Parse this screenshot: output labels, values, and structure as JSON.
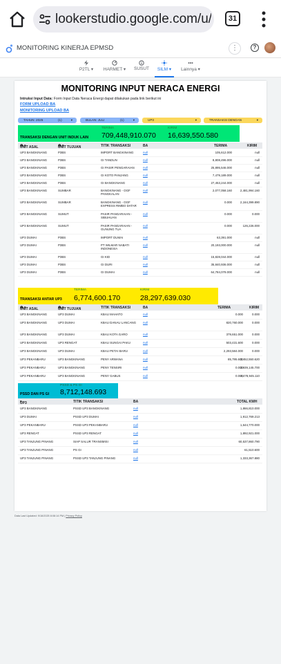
{
  "browser": {
    "url": "lookerstudio.google.com/u/0",
    "tab_count": "31"
  },
  "app": {
    "title": "MONITORING KINERJA EPMSD"
  },
  "nav_tabs": [
    {
      "label": "P2TL",
      "icon": "bolt-icon",
      "has_menu": true
    },
    {
      "label": "HARMET",
      "icon": "gauge-icon",
      "has_menu": true
    },
    {
      "label": "SUSUT",
      "icon": "info-icon",
      "has_menu": false
    },
    {
      "label": "SILM",
      "icon": "sun-icon",
      "has_menu": true,
      "active": true
    },
    {
      "label": "Lainnya",
      "icon": "dots-icon",
      "has_menu": true
    }
  ],
  "report": {
    "title": "MONITORING INPUT NERACA ENERGI",
    "intro_bold": "Intruksi Input Data:",
    "intro_text": " Form Input Data Neraca Energi dapat dilakukan pada link berikut ini",
    "links": [
      "FORM UPLOAD BA",
      "MONITORING UPLOAD BA"
    ],
    "filters": [
      {
        "label": "TAHUN: 2025",
        "count": "(1)"
      },
      {
        "label": "BULAN: JULI",
        "count": "(1)"
      },
      {
        "label": "UP3",
        "count": ""
      },
      {
        "label": "TRANSAKSI DENGAN",
        "count": ""
      }
    ],
    "section1": {
      "title": "TRANSAKSI DENGAN UNIT INDUK LAIN",
      "terima_label": "TERIMA",
      "terima_value": "709,448,910.070",
      "kirim_label": "KIRIM",
      "kirim_value": "16,639,550.580",
      "headers": [
        "UNIT ASAL",
        "UNIT TUJUAN",
        "TITIK TRANSAKSI",
        "BA",
        "TERIMA",
        "KIRIM"
      ],
      "rows": [
        [
          "UP3 BANGKINANG",
          "P3BS",
          "IMPORT BANGKINANG",
          "null",
          "105,612.000",
          "null"
        ],
        [
          "UP3 BANGKINANG",
          "P3BS",
          "GI TANDUN",
          "null",
          "8,808,496.000",
          "null"
        ],
        [
          "UP3 BANGKINANG",
          "P3BS",
          "GI PASIR PENGARAIAN",
          "null",
          "25,895,546.000",
          "null"
        ],
        [
          "UP3 BANGKINANG",
          "P3BS",
          "GI KOTO PANJANG",
          "null",
          "7,479,189.000",
          "null"
        ],
        [
          "UP3 BANGKINANG",
          "P3BS",
          "GI BANGKINANG",
          "null",
          "27,453,244.000",
          "null"
        ],
        [
          "UP3 BANGKINANG",
          "SUMBAR",
          "BANGKINANG - OGF PANGKALAN",
          "null",
          "2,077,058.160",
          "2,481,994.160"
        ],
        [
          "UP3 BANGKINANG",
          "SUMBAR",
          "BANGKINANG - OGF EXPRESS RIMBO DATAR",
          "null",
          "0.000",
          "2,164,399.890"
        ],
        [
          "UP3 BANGKINANG",
          "SUMUT",
          "PASIR PANGARAIAN - SIBUHUAN",
          "null",
          "0.000",
          "0.000"
        ],
        [
          "UP3 BANGKINANG",
          "SUMUT",
          "PASIR PANGARAIAN - GUNUNG TUA",
          "null",
          "0.000",
          "126,226.000"
        ],
        [
          "UP3 DUMAI",
          "P3BS",
          "IMPORT DUMAI",
          "null",
          "63,391.000",
          "null"
        ],
        [
          "UP3 DUMAI",
          "P3BS",
          "PT WILMAR NABATI INDONESIA",
          "null",
          "20,193,000.000",
          "null"
        ],
        [
          "UP3 DUMAI",
          "P3BS",
          "GI KID",
          "null",
          "15,828,044.000",
          "null"
        ],
        [
          "UP3 DUMAI",
          "P3BS",
          "GI DURI",
          "null",
          "35,840,936.000",
          "null"
        ],
        [
          "UP3 DUMAI",
          "P3BS",
          "GI DUMAI",
          "null",
          "64,784,078.000",
          "null"
        ]
      ]
    },
    "section2": {
      "title": "TRANSAKSI ANTAR UP3",
      "terima_label": "TERIMA",
      "terima_value": "6,774,600.170",
      "kirim_label": "KIRIM",
      "kirim_value": "28,297,639.030",
      "headers": [
        "UNIT ASAL",
        "UNIT TUJUAN",
        "TITIK TRANSAKSI",
        "BA",
        "TERIMA",
        "KIRIM"
      ],
      "rows": [
        [
          "UP3 BANGKINANG",
          "UP3 DUMAI",
          "KBAU MAHATO",
          "null",
          "0.000",
          "0.000"
        ],
        [
          "UP3 BANGKINANG",
          "UP3 DUMAI",
          "KBAU DANAU LANCANG",
          "null",
          "820,760.000",
          "0.000"
        ],
        [
          "UP3 BANGKINANG",
          "UP3 DUMAI",
          "KBAU KOTA GARO",
          "null",
          "379,651.000",
          "0.000"
        ],
        [
          "UP3 BANGKINANG",
          "UP3 RENGAT",
          "KBAU SUNGAI PAKU",
          "null",
          "503,431.600",
          "0.000"
        ],
        [
          "UP3 BANGKINANG",
          "UP3 DUMAI",
          "KBAU PETAI BARU",
          "null",
          "2,293,584.000",
          "0.000"
        ],
        [
          "UP3 PEKANBARU",
          "UP3 BANGKINANG",
          "PENY ARWANA",
          "null",
          "85,795.600",
          "3,452,550.620"
        ],
        [
          "UP3 PEKANBARU",
          "UP3 BANGKINANG",
          "PENY TENSIRI",
          "null",
          "0.000",
          "3,939,145.700"
        ],
        [
          "UP3 PEKANBARU",
          "UP3 BANGKINANG",
          "PENY GABUS",
          "null",
          "0.000",
          "4,478,945.110"
        ]
      ]
    },
    "section3": {
      "title": "PSSD DAN PS GI",
      "total_label": "PSSD & PS GI",
      "total_value": "8,712,148.693",
      "headers": [
        "UP3",
        "TITIK TRANSAKSI",
        "BA",
        "TOTAL KWH"
      ],
      "rows": [
        [
          "UP3 BANGKINANG",
          "PSSD UP3 BANGKINANG",
          "null",
          "1,866,810.000"
        ],
        [
          "UP3 DUMAI",
          "PSSD UP3 DUMAI",
          "null",
          "1,912,769.213"
        ],
        [
          "UP3 PEKANBARU",
          "PSSD UP3 PEKANBARU",
          "null",
          "1,644,770.000"
        ],
        [
          "UP3 RENGAT",
          "PSSD UP3 RENGAT",
          "null",
          "1,892,921.000"
        ],
        [
          "UP3 TANJUNG PINANG",
          "SIAP SALUR TRANSMISI",
          "null",
          "60,537,860.790"
        ],
        [
          "UP3 TANJUNG PINANG",
          "PS GI",
          "null",
          "61,510.600"
        ],
        [
          "UP3 TANJUNG PINANG",
          "PSSD UP3 TANJUNG PINANG",
          "null",
          "1,333,367.880"
        ]
      ]
    }
  },
  "footer": {
    "updated": "Data Last Updated: 9/16/2025 8:08:14 PM",
    "separator": " | ",
    "privacy": "Privacy Policy"
  },
  "colors": {
    "accent": "#1a73e8",
    "highlight_green": "#00e676",
    "highlight_yellow": "#ffea00",
    "highlight_cyan": "#00bcd4",
    "filter_yellow": "#fbd75b",
    "filter_blue": "#8ab4f8"
  }
}
